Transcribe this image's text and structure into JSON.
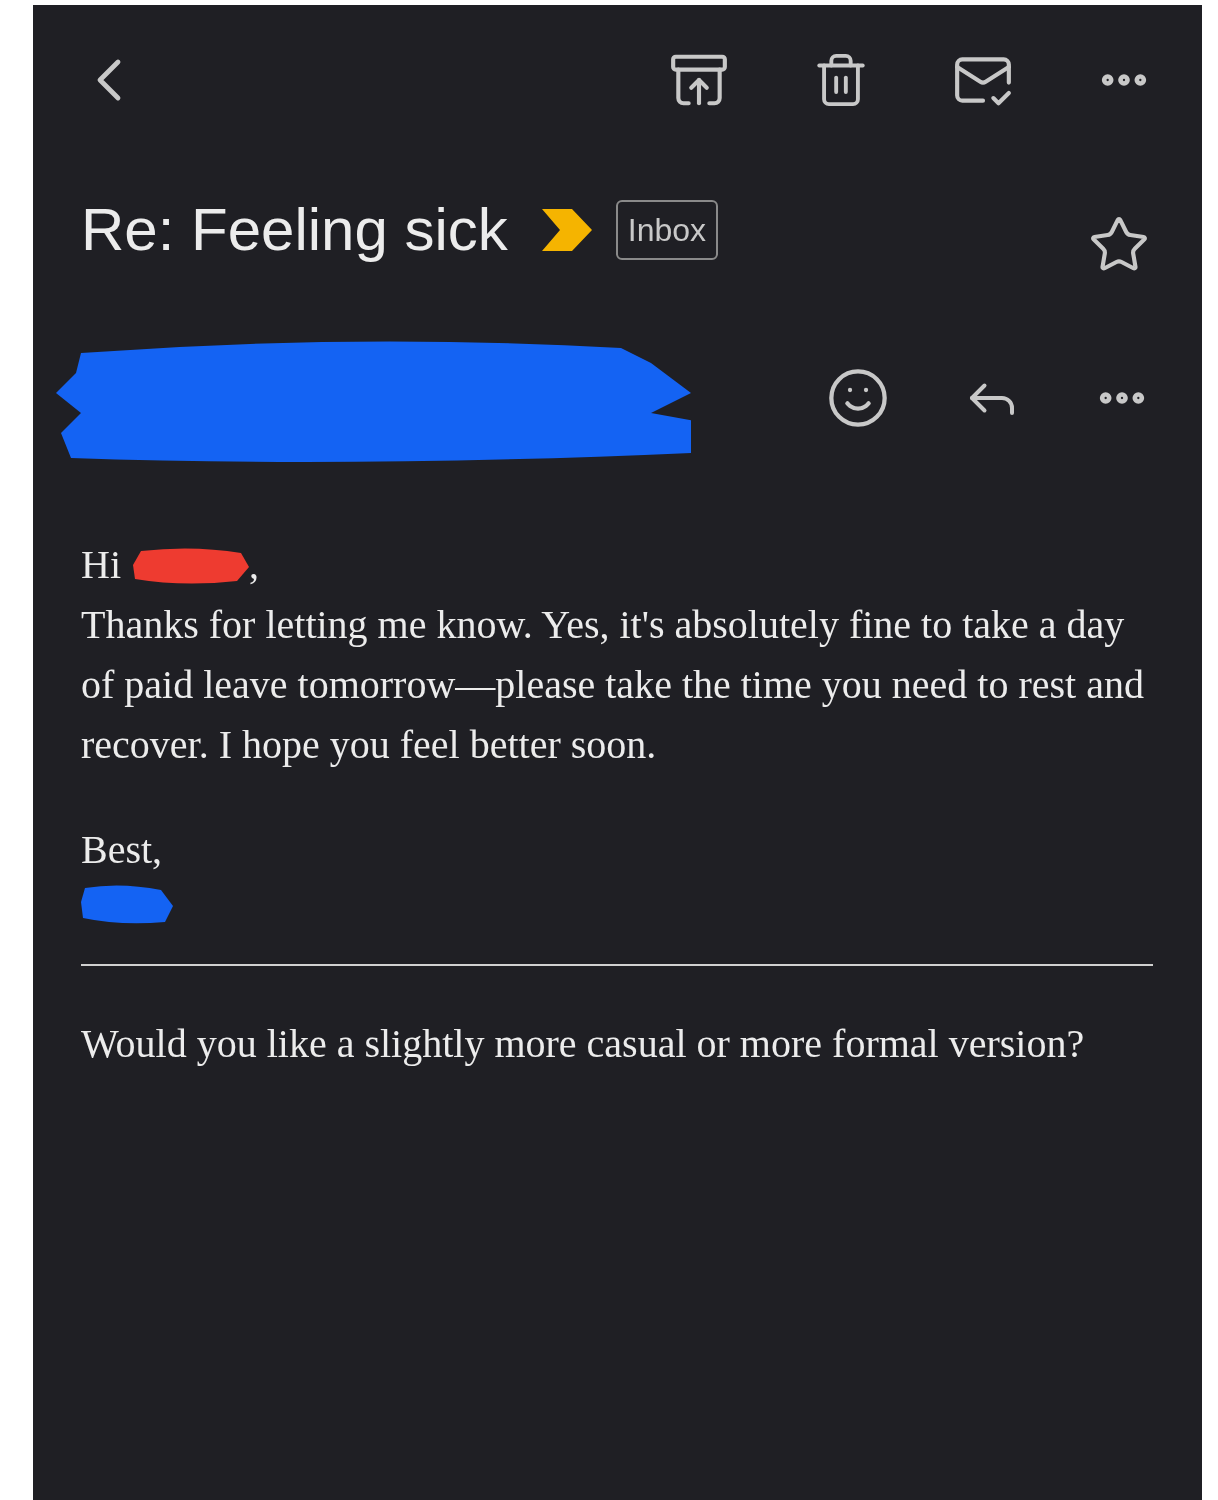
{
  "subject": "Re: Feeling sick",
  "label": "Inbox",
  "important": true,
  "starred": false,
  "greeting": "Hi",
  "greeting_suffix": ",",
  "body": "Thanks for letting me know. Yes, it's absolutely fine to take a day of paid leave tomorrow—please take the time you need to rest and recover. I hope you feel better soon.",
  "closing": "Best,",
  "footer": "Would you like a slightly more casual or more formal version?"
}
